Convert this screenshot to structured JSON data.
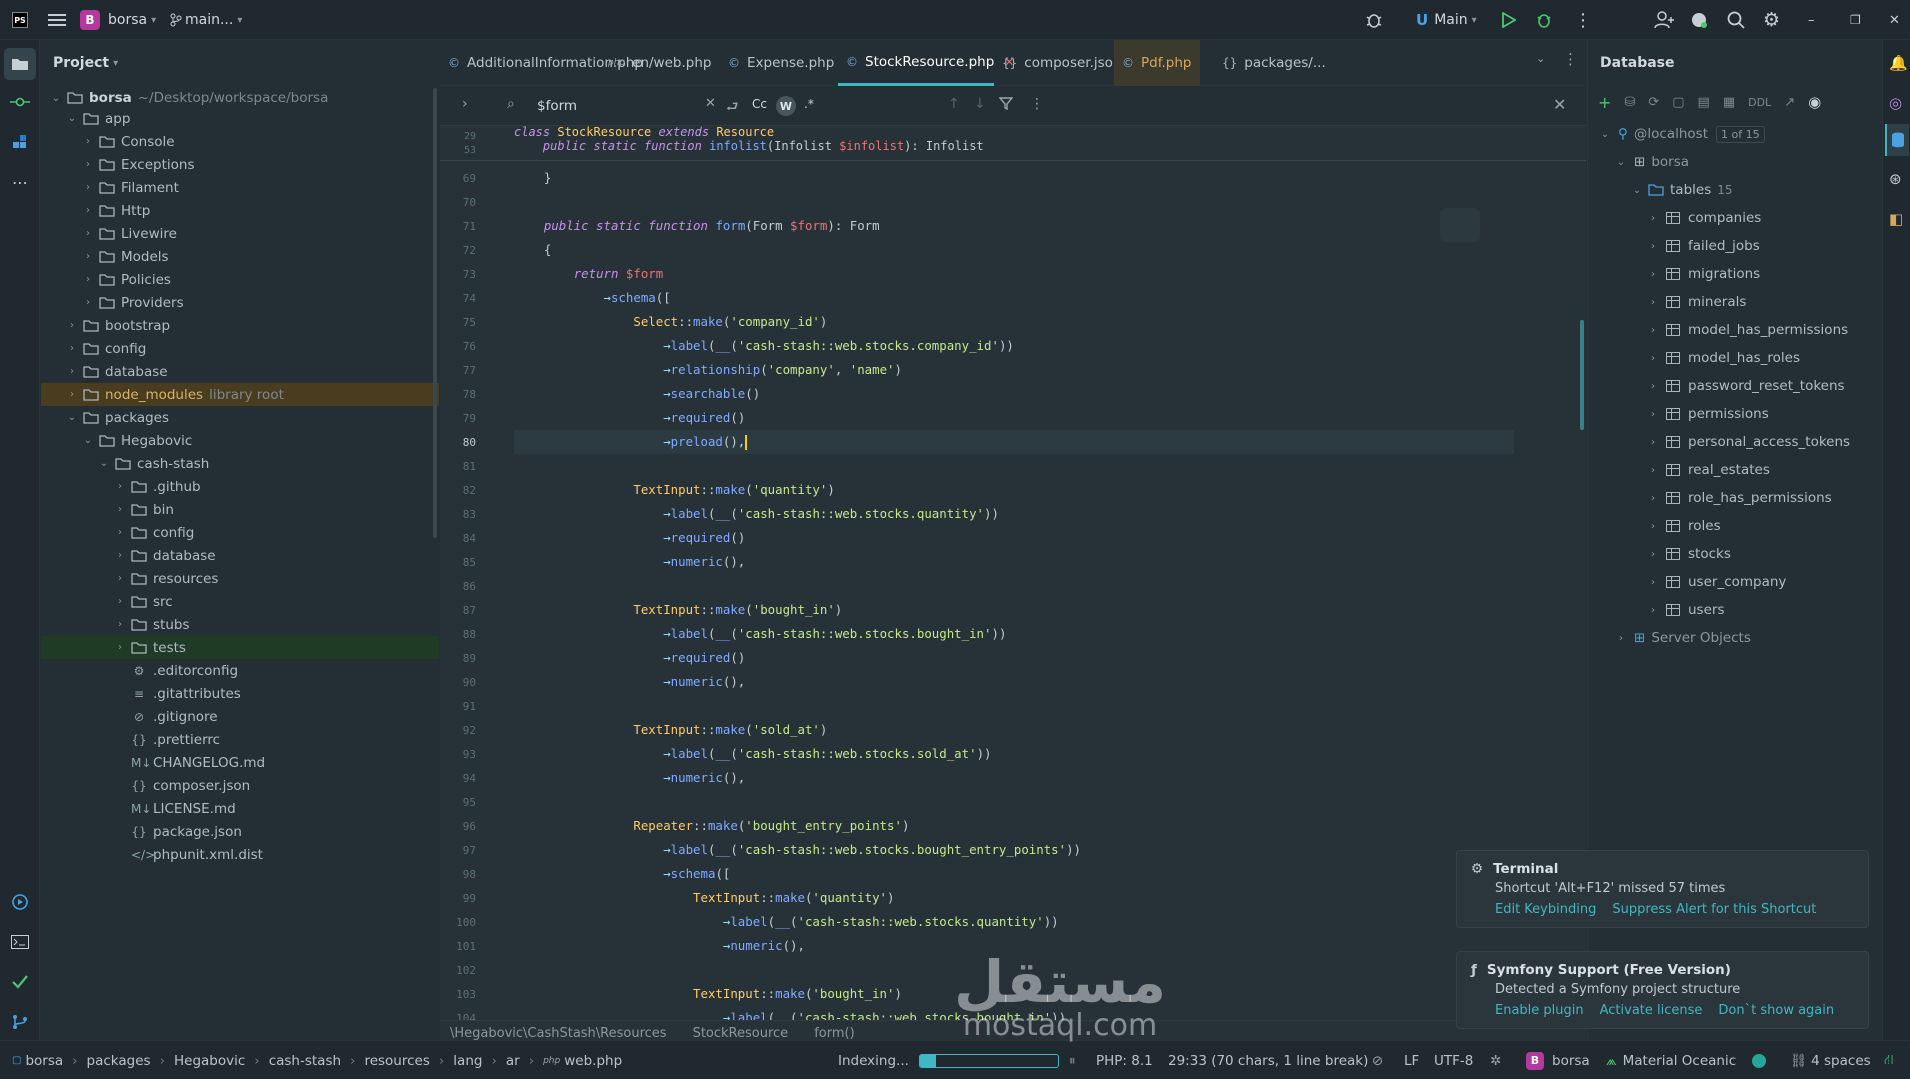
{
  "titlebar": {
    "app_icon": "PS",
    "project_badge": "B",
    "project_name": "borsa",
    "branch": "main...",
    "run_config": "Main",
    "colors": {
      "accent": "#3fb8c4",
      "badge": "#b33a9c"
    }
  },
  "project_panel": {
    "title": "Project",
    "root": {
      "name": "borsa",
      "path": "~/Desktop/workspace/borsa"
    },
    "tree": [
      {
        "label": "app",
        "depth": 1,
        "type": "folder",
        "open": true
      },
      {
        "label": "Console",
        "depth": 2,
        "type": "folder"
      },
      {
        "label": "Exceptions",
        "depth": 2,
        "type": "folder"
      },
      {
        "label": "Filament",
        "depth": 2,
        "type": "folder"
      },
      {
        "label": "Http",
        "depth": 2,
        "type": "folder"
      },
      {
        "label": "Livewire",
        "depth": 2,
        "type": "folder"
      },
      {
        "label": "Models",
        "depth": 2,
        "type": "folder"
      },
      {
        "label": "Policies",
        "depth": 2,
        "type": "folder"
      },
      {
        "label": "Providers",
        "depth": 2,
        "type": "folder"
      },
      {
        "label": "bootstrap",
        "depth": 1,
        "type": "folder"
      },
      {
        "label": "config",
        "depth": 1,
        "type": "folder"
      },
      {
        "label": "database",
        "depth": 1,
        "type": "folder"
      },
      {
        "label": "node_modules",
        "depth": 1,
        "type": "folder",
        "sub": "library root",
        "highlight": "node"
      },
      {
        "label": "packages",
        "depth": 1,
        "type": "folder",
        "open": true
      },
      {
        "label": "Hegabovic",
        "depth": 2,
        "type": "folder",
        "open": true
      },
      {
        "label": "cash-stash",
        "depth": 3,
        "type": "folder",
        "open": true
      },
      {
        "label": ".github",
        "depth": 4,
        "type": "folder"
      },
      {
        "label": "bin",
        "depth": 4,
        "type": "folder"
      },
      {
        "label": "config",
        "depth": 4,
        "type": "folder"
      },
      {
        "label": "database",
        "depth": 4,
        "type": "folder"
      },
      {
        "label": "resources",
        "depth": 4,
        "type": "folder"
      },
      {
        "label": "src",
        "depth": 4,
        "type": "folder"
      },
      {
        "label": "stubs",
        "depth": 4,
        "type": "folder"
      },
      {
        "label": "tests",
        "depth": 4,
        "type": "folder",
        "highlight": "tests"
      },
      {
        "label": ".editorconfig",
        "depth": 4,
        "type": "file",
        "icon": "⚙"
      },
      {
        "label": ".gitattributes",
        "depth": 4,
        "type": "file",
        "icon": "≡"
      },
      {
        "label": ".gitignore",
        "depth": 4,
        "type": "file",
        "icon": "⊘"
      },
      {
        "label": ".prettierrc",
        "depth": 4,
        "type": "file",
        "icon": "{}"
      },
      {
        "label": "CHANGELOG.md",
        "depth": 4,
        "type": "file",
        "icon": "M↓"
      },
      {
        "label": "composer.json",
        "depth": 4,
        "type": "file",
        "icon": "{}"
      },
      {
        "label": "LICENSE.md",
        "depth": 4,
        "type": "file",
        "icon": "M↓"
      },
      {
        "label": "package.json",
        "depth": 4,
        "type": "file",
        "icon": "{}"
      },
      {
        "label": "phpunit.xml.dist",
        "depth": 4,
        "type": "file",
        "icon": "</>"
      }
    ]
  },
  "tabs": [
    {
      "label": "AdditionalInformation.php",
      "icon": "©"
    },
    {
      "label": "en/web.php",
      "icon": "php"
    },
    {
      "label": "Expense.php",
      "icon": "©"
    },
    {
      "label": "StockResource.php",
      "icon": "©",
      "active": true
    },
    {
      "label": "composer.json",
      "icon": "{}"
    },
    {
      "label": "Pdf.php",
      "icon": "©",
      "pdf": true
    },
    {
      "label": "packages/...",
      "icon": "{}"
    }
  ],
  "find": {
    "value": "$form",
    "case_label": "Cc",
    "word_label": "W",
    "regex_label": ".*"
  },
  "sticky_lines": [
    {
      "n": "29",
      "html": "<span class='kw'>class</span> <span class='cls'>StockResource</span> <span class='kw'>extends</span> <span class='cls'>Resource</span>"
    },
    {
      "n": "53",
      "html": "    <span class='kw'>public static function</span> <span class='fn'>infolist</span>(Infolist <span class='var'>$infolist</span>): Infolist"
    }
  ],
  "code_lines": [
    {
      "n": "69",
      "html": "    }"
    },
    {
      "n": "70",
      "html": ""
    },
    {
      "n": "71",
      "html": "    <span class='kw'>public static function</span> <span class='fn'>form</span>(Form <span class='var'>$form</span>): Form"
    },
    {
      "n": "72",
      "html": "    {"
    },
    {
      "n": "73",
      "html": "        <span class='kw'>return</span> <span class='var'>$form</span>"
    },
    {
      "n": "74",
      "html": "            <span class='op'>→</span><span class='fn'>schema</span>(["
    },
    {
      "n": "75",
      "html": "                <span class='cls'>Select</span>::<span class='fn'>make</span>(<span class='str'>'company_id'</span>)"
    },
    {
      "n": "76",
      "html": "                    <span class='op'>→</span><span class='fn'>label</span>(<span class='fn'>__</span>(<span class='str'>'cash-stash::web.stocks.company_id'</span>))"
    },
    {
      "n": "77",
      "html": "                    <span class='op'>→</span><span class='fn'>relationship</span>(<span class='str'>'company'</span>, <span class='str'>'name'</span>)"
    },
    {
      "n": "78",
      "html": "                    <span class='op'>→</span><span class='fn'>searchable</span>()"
    },
    {
      "n": "79",
      "html": "                    <span class='op'>→</span><span class='fn'>required</span>()"
    },
    {
      "n": "80",
      "html": "                    <span class='op'>→</span><span class='fn'>preload</span>(),<span class='caret'></span>",
      "current": true
    },
    {
      "n": "81",
      "html": ""
    },
    {
      "n": "82",
      "html": "                <span class='cls'>TextInput</span>::<span class='fn'>make</span>(<span class='str'>'quantity'</span>)"
    },
    {
      "n": "83",
      "html": "                    <span class='op'>→</span><span class='fn'>label</span>(<span class='fn'>__</span>(<span class='str'>'cash-stash::web.stocks.quantity'</span>))"
    },
    {
      "n": "84",
      "html": "                    <span class='op'>→</span><span class='fn'>required</span>()"
    },
    {
      "n": "85",
      "html": "                    <span class='op'>→</span><span class='fn'>numeric</span>(),"
    },
    {
      "n": "86",
      "html": ""
    },
    {
      "n": "87",
      "html": "                <span class='cls'>TextInput</span>::<span class='fn'>make</span>(<span class='str'>'bought_in'</span>)"
    },
    {
      "n": "88",
      "html": "                    <span class='op'>→</span><span class='fn'>label</span>(<span class='fn'>__</span>(<span class='str'>'cash-stash::web.stocks.bought_in'</span>))"
    },
    {
      "n": "89",
      "html": "                    <span class='op'>→</span><span class='fn'>required</span>()"
    },
    {
      "n": "90",
      "html": "                    <span class='op'>→</span><span class='fn'>numeric</span>(),"
    },
    {
      "n": "91",
      "html": ""
    },
    {
      "n": "92",
      "html": "                <span class='cls'>TextInput</span>::<span class='fn'>make</span>(<span class='str'>'sold_at'</span>)"
    },
    {
      "n": "93",
      "html": "                    <span class='op'>→</span><span class='fn'>label</span>(<span class='fn'>__</span>(<span class='str'>'cash-stash::web.stocks.sold_at'</span>))"
    },
    {
      "n": "94",
      "html": "                    <span class='op'>→</span><span class='fn'>numeric</span>(),"
    },
    {
      "n": "95",
      "html": ""
    },
    {
      "n": "96",
      "html": "                <span class='cls'>Repeater</span>::<span class='fn'>make</span>(<span class='str'>'bought_entry_points'</span>)"
    },
    {
      "n": "97",
      "html": "                    <span class='op'>→</span><span class='fn'>label</span>(<span class='fn'>__</span>(<span class='str'>'cash-stash::web.stocks.bought_entry_points'</span>))"
    },
    {
      "n": "98",
      "html": "                    <span class='op'>→</span><span class='fn'>schema</span>(["
    },
    {
      "n": "99",
      "html": "                        <span class='cls'>TextInput</span>::<span class='fn'>make</span>(<span class='str'>'quantity'</span>)"
    },
    {
      "n": "100",
      "html": "                            <span class='op'>→</span><span class='fn'>label</span>(<span class='fn'>__</span>(<span class='str'>'cash-stash::web.stocks.quantity'</span>))"
    },
    {
      "n": "101",
      "html": "                            <span class='op'>→</span><span class='fn'>numeric</span>(),"
    },
    {
      "n": "102",
      "html": ""
    },
    {
      "n": "103",
      "html": "                        <span class='cls'>TextInput</span>::<span class='fn'>make</span>(<span class='str'>'bought_in'</span>)"
    },
    {
      "n": "104",
      "html": "                            <span class='op'>→</span><span class='fn'>label</span>(<span class='fn'>__</span>(<span class='str'>'cash-stash::web.stocks.bought_in'</span>))"
    }
  ],
  "breadcrumb": [
    "\\Hegabovic\\CashStash\\Resources",
    "StockResource",
    "form()"
  ],
  "database": {
    "title": "Database",
    "toolbar_ddl": "DDL",
    "host": "@localhost",
    "host_of": "1 of 15",
    "schema": "borsa",
    "tables_label": "tables",
    "tables_count": "15",
    "tables": [
      "companies",
      "failed_jobs",
      "migrations",
      "minerals",
      "model_has_permissions",
      "model_has_roles",
      "password_reset_tokens",
      "permissions",
      "personal_access_tokens",
      "real_estates",
      "role_has_permissions",
      "roles",
      "stocks",
      "user_company",
      "users"
    ],
    "server_objects": "Server Objects"
  },
  "notifications": [
    {
      "title": "Terminal",
      "body": "Shortcut 'Alt+F12' missed 57 times",
      "links": [
        "Edit Keybinding",
        "Suppress Alert for this Shortcut"
      ]
    },
    {
      "title": "Symfony Support (Free Version)",
      "body": "Detected a Symfony project structure",
      "links": [
        "Enable plugin",
        "Activate license",
        "Don`t show again"
      ]
    }
  ],
  "statusbar": {
    "path": [
      "borsa",
      "packages",
      "Hegabovic",
      "cash-stash",
      "resources",
      "lang",
      "ar",
      "web.php"
    ],
    "indexing": "Indexing...",
    "indexing_progress": 0.12,
    "php": "PHP: 8.1",
    "position": "29:33 (70 chars, 1 line break)",
    "line_sep": "LF",
    "encoding": "UTF-8",
    "project": "borsa",
    "theme": "Material Oceanic",
    "indent": "4 spaces"
  },
  "watermark": {
    "arabic": "مستقل",
    "latin": "mostaql.com"
  }
}
